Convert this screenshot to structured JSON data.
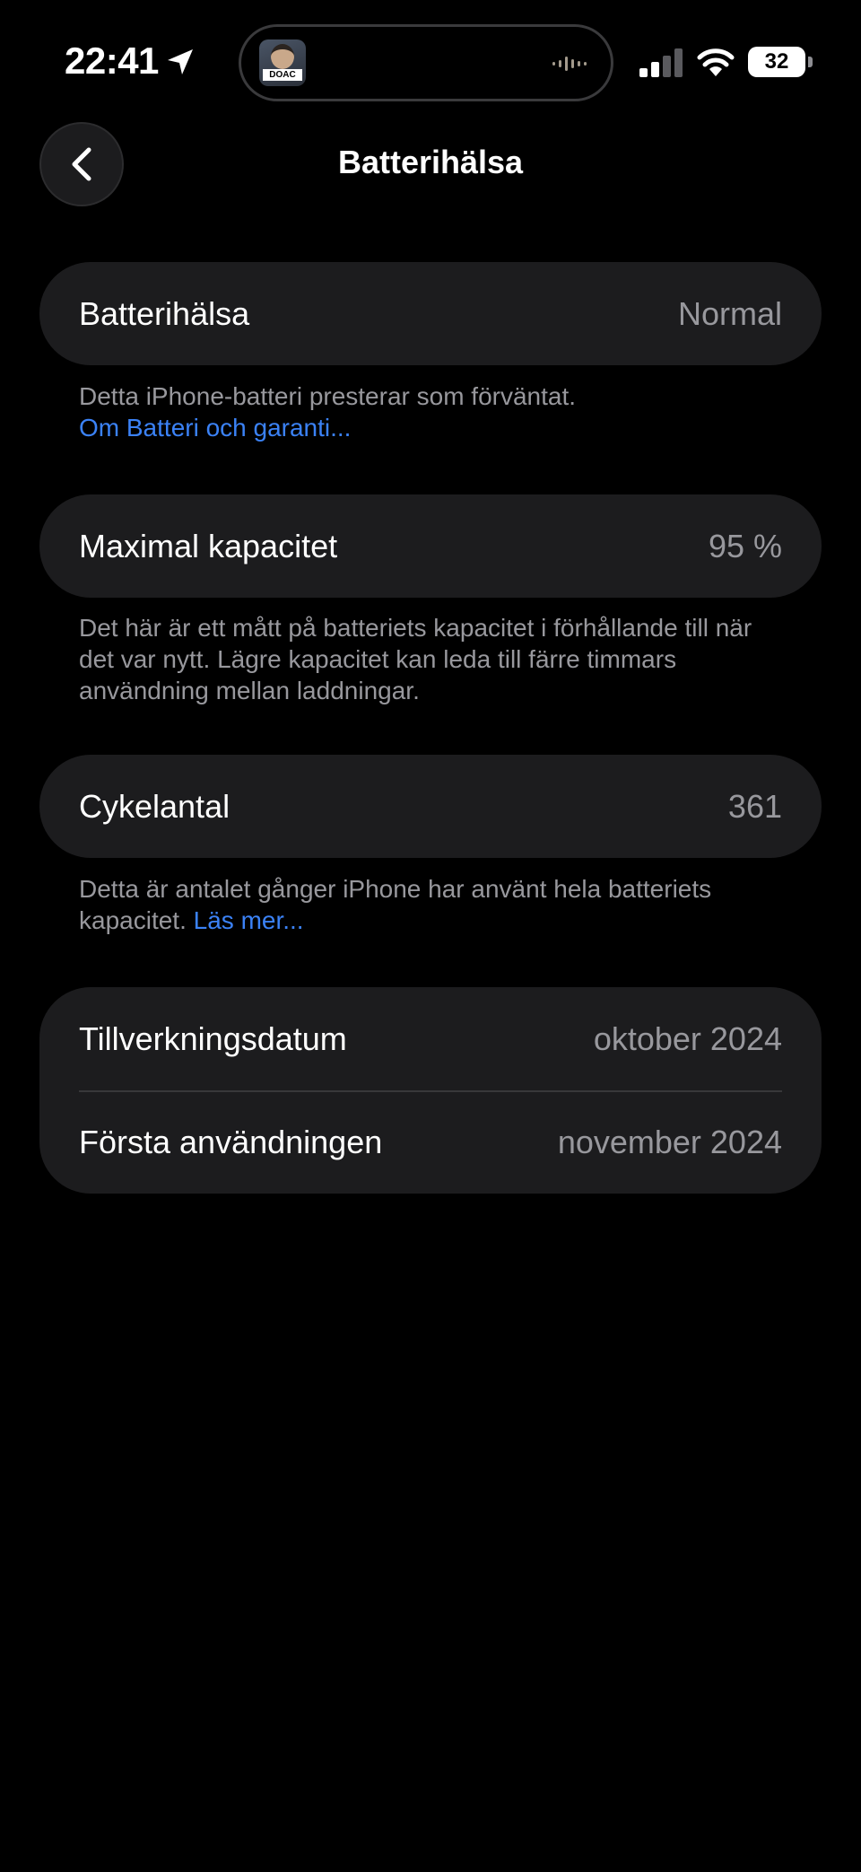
{
  "status_bar": {
    "time": "22:41",
    "battery_level": "32",
    "island_thumb_label": "DOAC"
  },
  "nav": {
    "title": "Batterihälsa"
  },
  "health_section": {
    "label": "Batterihälsa",
    "value": "Normal",
    "footnote_text": "Detta iPhone-batteri presterar som förväntat.",
    "footnote_link": "Om Batteri och garanti..."
  },
  "capacity_section": {
    "label": "Maximal kapacitet",
    "value": "95 %",
    "footnote_text": "Det här är ett mått på batteriets kapacitet i förhållande till när det var nytt. Lägre kapacitet kan leda till färre timmars användning mellan laddningar."
  },
  "cycle_section": {
    "label": "Cykelantal",
    "value": "361",
    "footnote_text": "Detta är antalet gånger iPhone har använt hela batteriets kapacitet.",
    "footnote_link": "Läs mer..."
  },
  "dates_section": {
    "rows": [
      {
        "label": "Tillverkningsdatum",
        "value": "oktober 2024"
      },
      {
        "label": "Första användningen",
        "value": "november 2024"
      }
    ]
  },
  "colors": {
    "background": "#000000",
    "card": "#1c1c1e",
    "secondary_text": "#98989d",
    "link": "#3b82f6"
  },
  "icons": {
    "back": "chevron-left-icon",
    "location": "location-arrow-icon",
    "signal": "cellular-signal-icon",
    "wifi": "wifi-icon",
    "battery": "battery-icon",
    "waveform": "audio-waveform-icon"
  }
}
